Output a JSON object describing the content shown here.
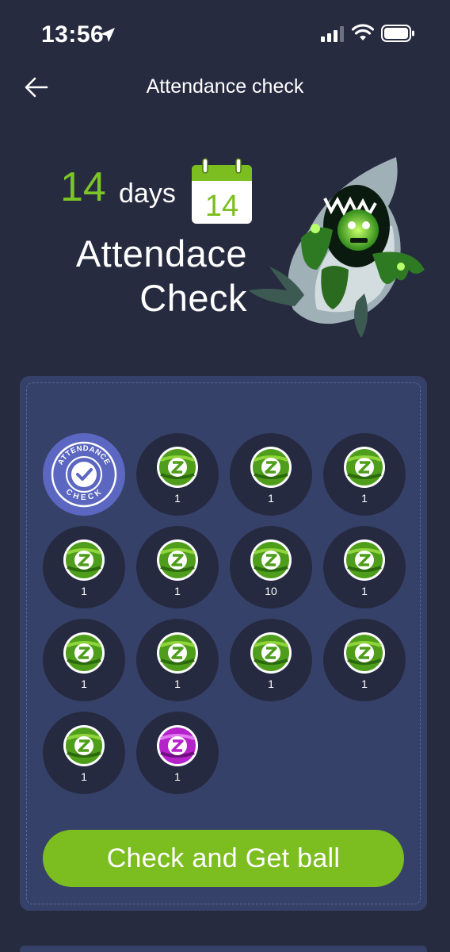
{
  "status_bar": {
    "time": "13:56",
    "icons": [
      "location-arrow-icon",
      "signal-icon",
      "wifi-icon",
      "battery-icon"
    ]
  },
  "nav": {
    "back_icon": "arrow-left-icon",
    "title": "Attendance check"
  },
  "hero": {
    "days_number": "14",
    "days_unit": "days",
    "calendar_number": "14",
    "title_line1": "Attendace",
    "title_line2": "Check",
    "mascot": "zombie-shark-illustration"
  },
  "stamp": {
    "top_text": "ATTENDANCE",
    "bottom_text": "CHECK"
  },
  "days": [
    {
      "status": "checked",
      "reward": ""
    },
    {
      "status": "pending",
      "ball": "green",
      "reward": "1"
    },
    {
      "status": "pending",
      "ball": "green",
      "reward": "1"
    },
    {
      "status": "pending",
      "ball": "green",
      "reward": "1"
    },
    {
      "status": "pending",
      "ball": "green",
      "reward": "1"
    },
    {
      "status": "pending",
      "ball": "green",
      "reward": "1"
    },
    {
      "status": "pending",
      "ball": "green",
      "reward": "10"
    },
    {
      "status": "pending",
      "ball": "green",
      "reward": "1"
    },
    {
      "status": "pending",
      "ball": "green",
      "reward": "1"
    },
    {
      "status": "pending",
      "ball": "green",
      "reward": "1"
    },
    {
      "status": "pending",
      "ball": "green",
      "reward": "1"
    },
    {
      "status": "pending",
      "ball": "green",
      "reward": "1"
    },
    {
      "status": "pending",
      "ball": "green",
      "reward": "1"
    },
    {
      "status": "pending",
      "ball": "purple",
      "reward": "1"
    }
  ],
  "action": {
    "button_label": "Check and Get ball"
  },
  "colors": {
    "background": "#272b40",
    "card": "#364169",
    "accent_green": "#7cbd1f",
    "checked_day": "#5b67c0",
    "ball_purple": "#b622c9"
  }
}
